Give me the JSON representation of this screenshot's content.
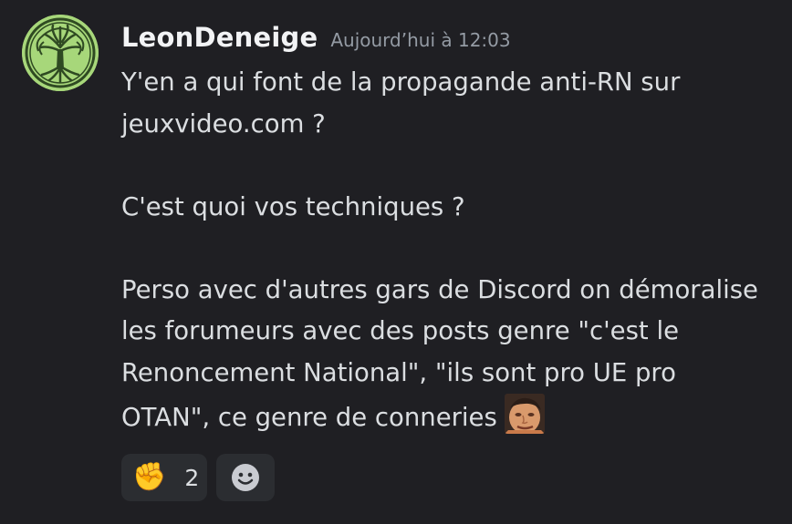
{
  "message": {
    "author": "LeonDeneige",
    "timestamp": "Aujourd’hui à 12:03",
    "lines": [
      "Y'en a qui font de la propagande anti-RN sur",
      "jeuxvideo.com ?",
      "",
      "C'est quoi vos techniques ?",
      "",
      "Perso avec d'autres gars de Discord on démoralise",
      "les forumeurs avec des posts genre \"c'est le",
      "Renoncement National\", \"ils sont pro UE pro",
      "OTAN\", ce genre de conneries"
    ],
    "inline_emote": "face-emote-icon"
  },
  "reactions": [
    {
      "emoji": "✊",
      "icon": "raised-fist-icon",
      "count": "2"
    },
    {
      "icon": "add-reaction-smiley-icon"
    }
  ],
  "colors": {
    "background": "#1f1f23",
    "username": "#f2f3f5",
    "timestamp": "#949ba4",
    "text": "#dbdee1",
    "reaction_bg": "#2b2d31",
    "avatar_bg": "#a7d77a"
  }
}
